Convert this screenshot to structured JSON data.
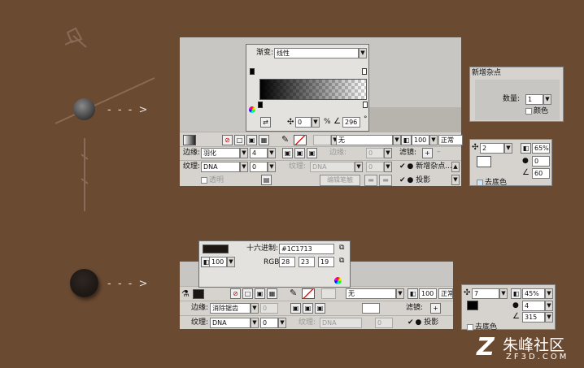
{
  "gradient_popup": {
    "title_label": "渐变:",
    "type_value": "线性",
    "offset_value": "0",
    "percent_symbol": "%",
    "angle_value": "296",
    "degree_symbol": "°"
  },
  "hex_popup": {
    "hex_label": "十六进制:",
    "hex_value": "#1C1713",
    "opacity_value": "100",
    "rgb_label": "RGB:",
    "r_value": "28",
    "g_value": "23",
    "b_value": "19"
  },
  "props_top": {
    "edge_label": "边缘:",
    "edge_value": "羽化",
    "edge_amount": "4",
    "texture_label": "纹理:",
    "texture_value": "DNA",
    "texture_amount": "0",
    "transparent_label": "透明",
    "stroke_value": "无",
    "edge2_label": "边缘:",
    "edge2_amount": "0",
    "texture2_label": "纹理:",
    "texture2_value": "DNA",
    "texture2_amount": "0",
    "edit_stroke_button": "编辑笔触",
    "opacity_value": "100",
    "blend_value": "正常",
    "filters_label": "滤镜:",
    "filter_items": [
      "新增杂点...",
      "投影"
    ]
  },
  "props_bottom": {
    "edge_label": "边缘:",
    "edge_value": "消除锯齿",
    "edge_amount": "0",
    "texture_label": "纹理:",
    "texture_value": "DNA",
    "texture_amount": "0",
    "stroke_value": "无",
    "texture2_label": "纹理:",
    "texture2_value": "DNA",
    "texture2_amount": "0",
    "opacity_value": "100",
    "blend_value": "正常",
    "filters_label": "滤镜:",
    "filter_items": [
      "投影"
    ]
  },
  "noise_dialog": {
    "title": "新增杂点",
    "amount_label": "数量:",
    "amount_value": "1",
    "color_label": "颜色"
  },
  "shadow_top": {
    "distance_value": "2",
    "opacity_value": "65%",
    "softness_value": "0",
    "angle_value": "60",
    "knockout_label": "去底色"
  },
  "shadow_bottom": {
    "distance_value": "7",
    "opacity_value": "45%",
    "softness_value": "4",
    "angle_value": "315",
    "knockout_label": "去底色"
  },
  "arrows": [
    "- - - >",
    "- - - >"
  ],
  "watermark": {
    "brand": "朱峰社区",
    "domain": "ZF3D.COM"
  },
  "colors": {
    "background": "#6b4a32",
    "panel": "#d6d3ce",
    "swatch_dark": "#1c1713",
    "accent_blue": "#0a246a"
  }
}
